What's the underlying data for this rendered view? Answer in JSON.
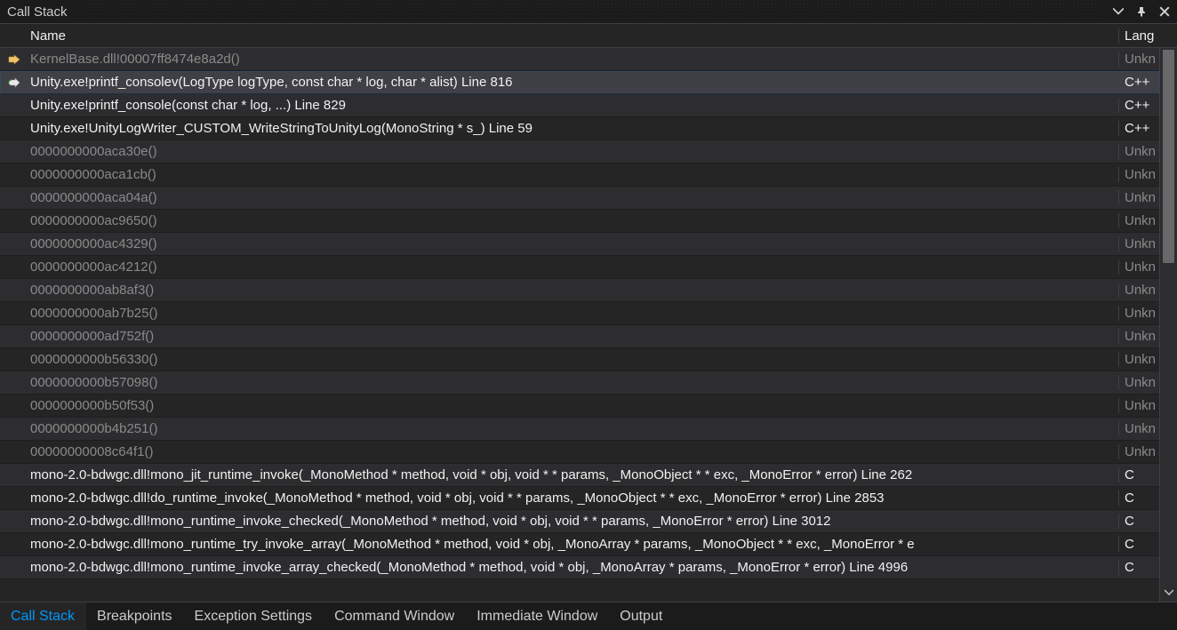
{
  "panel": {
    "title": "Call Stack",
    "columns": {
      "name": "Name",
      "language": "Lang"
    }
  },
  "frames": [
    {
      "icon": "current",
      "name": "KernelBase.dll!00007ff8474e8a2d()",
      "language": "Unkn",
      "dim": true,
      "selected": false
    },
    {
      "icon": "breakpoint",
      "name": "Unity.exe!printf_consolev(LogType logType, const char * log, char * alist) Line 816",
      "language": "C++",
      "dim": false,
      "selected": true
    },
    {
      "icon": "",
      "name": "Unity.exe!printf_console(const char * log, ...) Line 829",
      "language": "C++",
      "dim": false,
      "selected": false
    },
    {
      "icon": "",
      "name": "Unity.exe!UnityLogWriter_CUSTOM_WriteStringToUnityLog(MonoString * s_) Line 59",
      "language": "C++",
      "dim": false,
      "selected": false
    },
    {
      "icon": "",
      "name": "0000000000aca30e()",
      "language": "Unkn",
      "dim": true,
      "selected": false
    },
    {
      "icon": "",
      "name": "0000000000aca1cb()",
      "language": "Unkn",
      "dim": true,
      "selected": false
    },
    {
      "icon": "",
      "name": "0000000000aca04a()",
      "language": "Unkn",
      "dim": true,
      "selected": false
    },
    {
      "icon": "",
      "name": "0000000000ac9650()",
      "language": "Unkn",
      "dim": true,
      "selected": false
    },
    {
      "icon": "",
      "name": "0000000000ac4329()",
      "language": "Unkn",
      "dim": true,
      "selected": false
    },
    {
      "icon": "",
      "name": "0000000000ac4212()",
      "language": "Unkn",
      "dim": true,
      "selected": false
    },
    {
      "icon": "",
      "name": "0000000000ab8af3()",
      "language": "Unkn",
      "dim": true,
      "selected": false
    },
    {
      "icon": "",
      "name": "0000000000ab7b25()",
      "language": "Unkn",
      "dim": true,
      "selected": false
    },
    {
      "icon": "",
      "name": "0000000000ad752f()",
      "language": "Unkn",
      "dim": true,
      "selected": false
    },
    {
      "icon": "",
      "name": "0000000000b56330()",
      "language": "Unkn",
      "dim": true,
      "selected": false
    },
    {
      "icon": "",
      "name": "0000000000b57098()",
      "language": "Unkn",
      "dim": true,
      "selected": false
    },
    {
      "icon": "",
      "name": "0000000000b50f53()",
      "language": "Unkn",
      "dim": true,
      "selected": false
    },
    {
      "icon": "",
      "name": "0000000000b4b251()",
      "language": "Unkn",
      "dim": true,
      "selected": false
    },
    {
      "icon": "",
      "name": "00000000008c64f1()",
      "language": "Unkn",
      "dim": true,
      "selected": false
    },
    {
      "icon": "",
      "name": "mono-2.0-bdwgc.dll!mono_jit_runtime_invoke(_MonoMethod * method, void * obj, void * * params, _MonoObject * * exc, _MonoError * error) Line 262",
      "language": "C",
      "dim": false,
      "selected": false
    },
    {
      "icon": "",
      "name": "mono-2.0-bdwgc.dll!do_runtime_invoke(_MonoMethod * method, void * obj, void * * params, _MonoObject * * exc, _MonoError * error) Line 2853",
      "language": "C",
      "dim": false,
      "selected": false
    },
    {
      "icon": "",
      "name": "mono-2.0-bdwgc.dll!mono_runtime_invoke_checked(_MonoMethod * method, void * obj, void * * params, _MonoError * error) Line 3012",
      "language": "C",
      "dim": false,
      "selected": false
    },
    {
      "icon": "",
      "name": "mono-2.0-bdwgc.dll!mono_runtime_try_invoke_array(_MonoMethod * method, void * obj, _MonoArray * params, _MonoObject * * exc, _MonoError * e",
      "language": "C",
      "dim": false,
      "selected": false
    },
    {
      "icon": "",
      "name": "mono-2.0-bdwgc.dll!mono_runtime_invoke_array_checked(_MonoMethod * method, void * obj, _MonoArray * params, _MonoError * error) Line 4996",
      "language": "C",
      "dim": false,
      "selected": false
    }
  ],
  "tabs": [
    {
      "label": "Call Stack",
      "active": true
    },
    {
      "label": "Breakpoints",
      "active": false
    },
    {
      "label": "Exception Settings",
      "active": false
    },
    {
      "label": "Command Window",
      "active": false
    },
    {
      "label": "Immediate Window",
      "active": false
    },
    {
      "label": "Output",
      "active": false
    }
  ]
}
